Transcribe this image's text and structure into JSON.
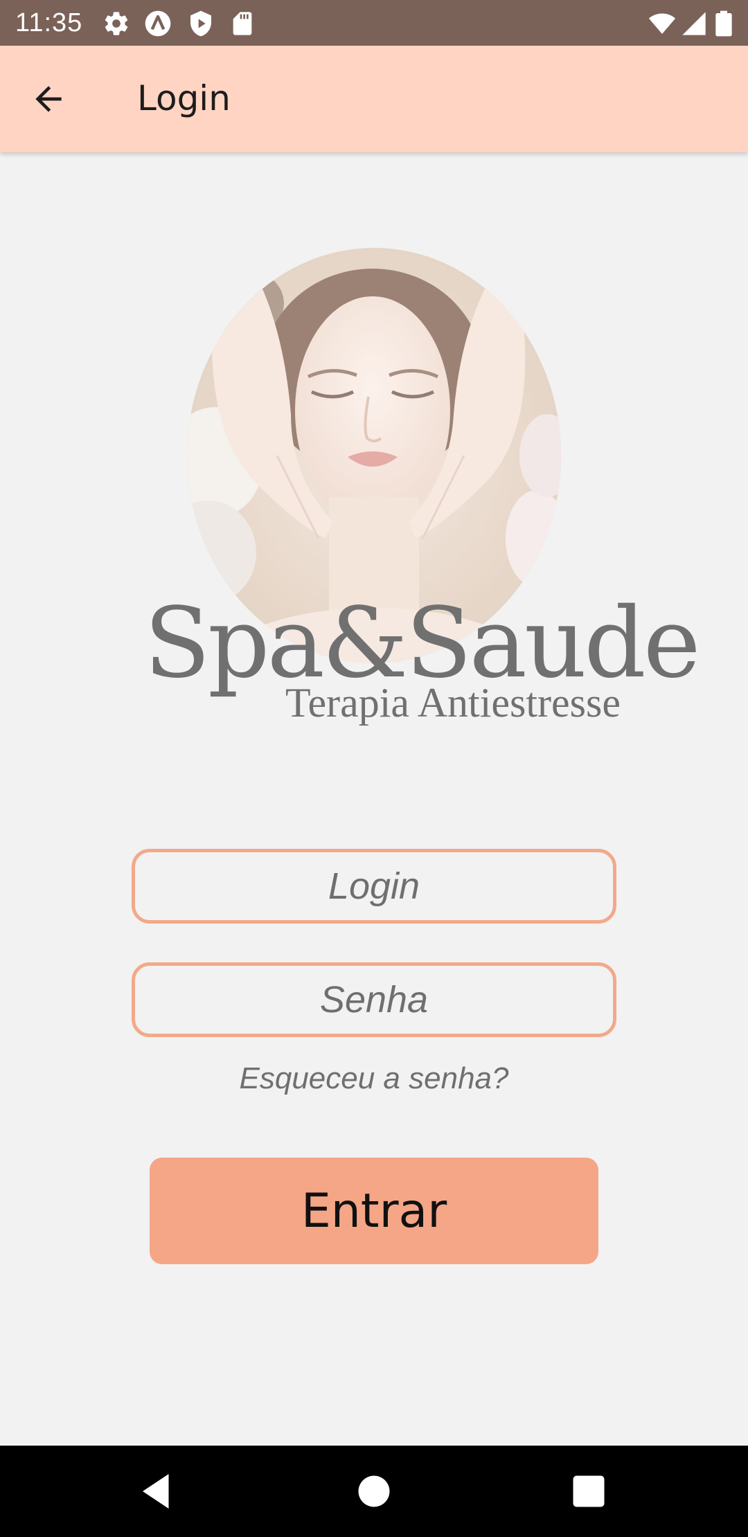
{
  "status_bar": {
    "time": "11:35",
    "left_icons": [
      "gear-icon",
      "a-circle-icon",
      "shield-play-icon",
      "sd-card-icon"
    ],
    "right_icons": [
      "wifi-icon",
      "signal-icon",
      "battery-icon"
    ]
  },
  "app_bar": {
    "title": "Login",
    "back_icon": "arrow-left-icon"
  },
  "logo": {
    "brand_name": "Spa&Saude",
    "tagline": "Terapia Antiestresse"
  },
  "form": {
    "login_placeholder": "Login",
    "login_value": "",
    "password_placeholder": "Senha",
    "password_value": "",
    "forgot_label": "Esqueceu a senha?",
    "submit_label": "Entrar"
  },
  "colors": {
    "status_bar": "#7a6259",
    "app_bar": "#ffd4c3",
    "background": "#f2f2f2",
    "field_border": "#f2a98a",
    "button": "#f4a687",
    "nav_bar": "#000000"
  },
  "nav_bar": {
    "icons": [
      "back-triangle-icon",
      "home-circle-icon",
      "recents-square-icon"
    ]
  }
}
